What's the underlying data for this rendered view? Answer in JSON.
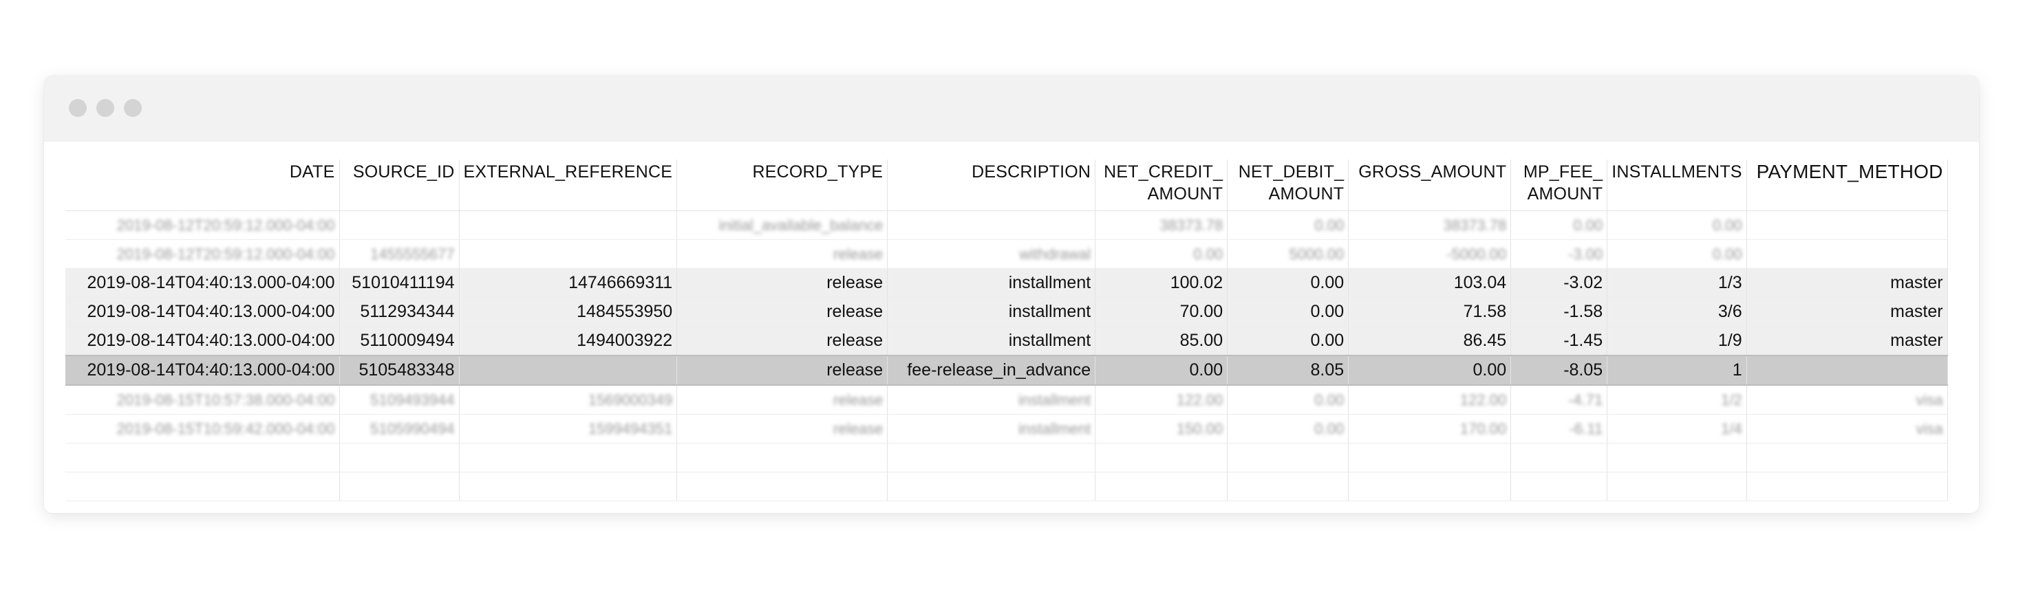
{
  "window": {
    "buttons": [
      "close",
      "minimize",
      "maximize"
    ]
  },
  "table": {
    "headers": {
      "date": "DATE",
      "source_id": "SOURCE_ID",
      "external_reference": "EXTERNAL_REFERENCE",
      "record_type": "RECORD_TYPE",
      "description": "DESCRIPTION",
      "net_credit_amount": "NET_CREDIT_ AMOUNT",
      "net_debit_amount": "NET_DEBIT_ AMOUNT",
      "gross_amount": "GROSS_AMOUNT",
      "mp_fee_amount": "MP_FEE_ AMOUNT",
      "installments": "INSTALLMENTS",
      "payment_method": "PAYMENT_METHOD"
    },
    "rows": [
      [
        "2019-08-12T20:59:12.000-04:00",
        "",
        "",
        "initial_available_balance",
        "",
        "38373.78",
        "0.00",
        "38373.78",
        "0.00",
        "0.00",
        ""
      ],
      [
        "2019-08-12T20:59:12.000-04:00",
        "1455555677",
        "",
        "release",
        "withdrawal",
        "0.00",
        "5000.00",
        "-5000.00",
        "-3.00",
        "0.00",
        ""
      ],
      [
        "2019-08-14T04:40:13.000-04:00",
        "51010411194",
        "14746669311",
        "release",
        "installment",
        "100.02",
        "0.00",
        "103.04",
        "-3.02",
        "1/3",
        "master"
      ],
      [
        "2019-08-14T04:40:13.000-04:00",
        "5112934344",
        "1484553950",
        "release",
        "installment",
        "70.00",
        "0.00",
        "71.58",
        "-1.58",
        "3/6",
        "master"
      ],
      [
        "2019-08-14T04:40:13.000-04:00",
        "5110009494",
        "1494003922",
        "release",
        "installment",
        "85.00",
        "0.00",
        "86.45",
        "-1.45",
        "1/9",
        "master"
      ],
      [
        "2019-08-14T04:40:13.000-04:00",
        "5105483348",
        "",
        "release",
        "fee-release_in_advance",
        "0.00",
        "8.05",
        "0.00",
        "-8.05",
        "1",
        ""
      ],
      [
        "2019-08-15T10:57:38.000-04:00",
        "5109493944",
        "1569000349",
        "release",
        "installment",
        "122.00",
        "0.00",
        "122.00",
        "-4.71",
        "1/2",
        "visa"
      ],
      [
        "2019-08-15T10:59:42.000-04:00",
        "5105990494",
        "1599494351",
        "release",
        "installment",
        "150.00",
        "0.00",
        "170.00",
        "-6.11",
        "1/4",
        "visa"
      ],
      [
        "",
        "",
        "",
        "",
        "",
        "",
        "",
        "",
        "",
        "",
        ""
      ],
      [
        "",
        "",
        "",
        "",
        "",
        "",
        "",
        "",
        "",
        "",
        ""
      ]
    ]
  }
}
